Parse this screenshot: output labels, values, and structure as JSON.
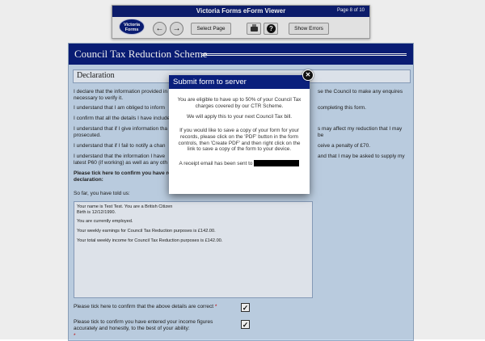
{
  "viewer": {
    "title": "Victoria Forms eForm Viewer",
    "page_indicator": "Page 8 of 10",
    "logo_line1": "Victoria",
    "logo_line2": "Forms",
    "back_glyph": "←",
    "forward_glyph": "→",
    "select_page_label": "Select Page",
    "help_glyph": "?",
    "show_errors_label": "Show Errors",
    "icons": [
      "back-arrow-icon",
      "forward-arrow-icon",
      "printer-icon",
      "help-icon"
    ]
  },
  "form": {
    "title": "Council Tax Reduction Scheme",
    "section": "Declaration",
    "lines": [
      "I declare that the information provided in",
      "se the Council to make any enquires",
      "necessary to verify it.",
      "I understand that I am obliged to inform",
      "completing this form.",
      "I confirm that all the details I have include",
      "I understand that if I give information tha",
      "s may affect my reduction that I may be",
      "prosecuted.",
      "I understand that if I fail to notify a chan",
      "ceive a penalty of £70.",
      "I understand that the information I have",
      "and that I may be asked to supply my",
      "latest P60 (if working) as well as any oth",
      "Please tick here to confirm you have read",
      "declaration:",
      "So far, you have told us:"
    ],
    "summary": [
      "Your name is Test Test. You are a British Citizen",
      "Birth is 12/12/1990.",
      "You are currently employed.",
      "Your weekly earnings for Council Tax Reduction purposes is £142.00.",
      "Your total weekly income for Council Tax Reduction purposes is £142.00."
    ],
    "confirm_details_label": "Please tick here to confirm that the above details are correct",
    "required_mark": "*",
    "confirm_income_label_1": "Please tick to confirm you have entered your income figures",
    "confirm_income_label_2": "accurately and honestly, to the best of your ability:",
    "check_glyph": "✓"
  },
  "modal": {
    "title": "Submit form to server",
    "close_glyph": "✕",
    "p1": "You are eligible to have up to 50% of your Council Tax charges covered by our CTR Scheme.",
    "p2": "We will apply this to your next Council Tax bill.",
    "p3": "If you would like to save a copy of your form for your records, please click on the 'PDF' button in the form controls, then 'Create PDF' and then right click on the link to save a copy of the form to your device.",
    "p4": "A receipt email has been sent to"
  },
  "colors": {
    "navy": "#0a1f7c",
    "form_background": "#c8dbef",
    "required": "#cc0000"
  }
}
